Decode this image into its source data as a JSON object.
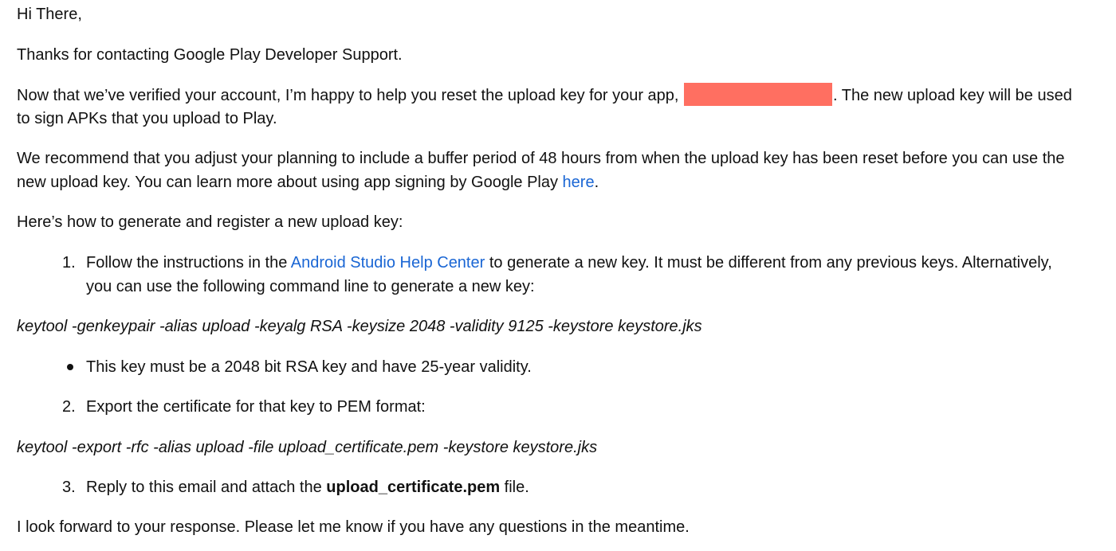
{
  "email": {
    "greeting": "Hi There,",
    "thanks": "Thanks for contacting Google Play Developer Support.",
    "verified": {
      "before": "Now that we’ve verified your account, I’m happy to help you reset the upload key for your app, ",
      "after": ". The new upload key will be used",
      "line2": "to sign APKs that you upload to Play.",
      "redaction_color": "#ff6f61"
    },
    "recommend": {
      "line1": "We recommend that you adjust your planning to include a buffer period of 48 hours from when the upload key has been reset before you can use the",
      "line2_before": "new upload key. You can learn more about using app signing by Google Play ",
      "link": "here",
      "line2_after": "."
    },
    "howto": "Here’s how to generate and register a new upload key:",
    "step1": {
      "number": "1.",
      "before": "Follow the instructions in the ",
      "link": "Android Studio Help Center",
      "after": " to generate a new key. It must be different from any previous keys. Alternatively,",
      "line2": "you can use the following command line to generate a new key:"
    },
    "command1": "keytool -genkeypair -alias upload -keyalg RSA -keysize 2048 -validity 9125 -keystore keystore.jks",
    "bullet_note": "This key must be a 2048 bit RSA key and have 25-year validity.",
    "step2": {
      "number": "2.",
      "text": "Export the certificate for that key to PEM format:"
    },
    "command2": "keytool -export -rfc -alias upload -file upload_certificate.pem -keystore keystore.jks",
    "step3": {
      "number": "3.",
      "before": "Reply to this email and attach the ",
      "bold": "upload_certificate.pem",
      "after": " file."
    },
    "closing": "I look forward to your response. Please let me know if you have any questions in the meantime."
  },
  "colors": {
    "text": "#111111",
    "link": "#1a66d4",
    "background": "#ffffff"
  }
}
